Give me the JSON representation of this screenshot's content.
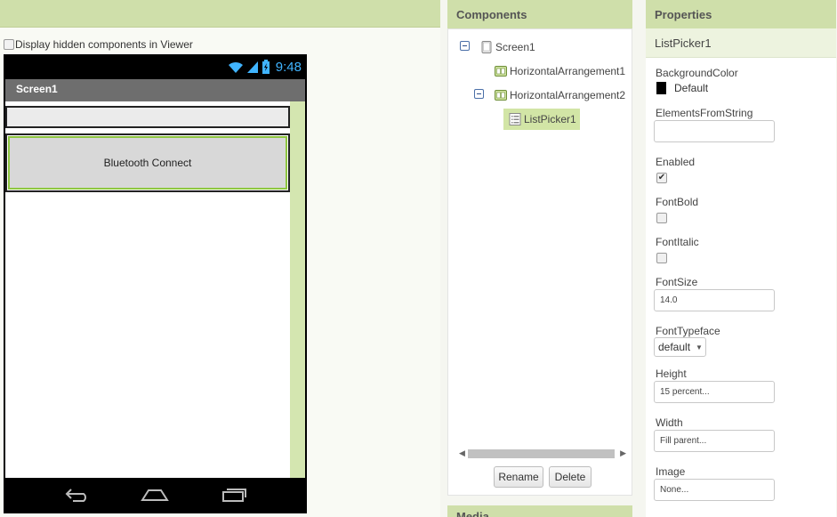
{
  "viewer": {
    "hidden_components_label": "Display hidden components in Viewer",
    "status_time": "9:48",
    "screen_title": "Screen1",
    "button_text": "Bluetooth Connect"
  },
  "components": {
    "header": "Components",
    "tree": [
      {
        "label": "Screen1",
        "icon": "screen-icon",
        "expanded": true
      },
      {
        "label": "HorizontalArrangement1",
        "icon": "horizontal-arrangement-icon"
      },
      {
        "label": "HorizontalArrangement2",
        "icon": "horizontal-arrangement-icon",
        "expanded": true
      },
      {
        "label": "ListPicker1",
        "icon": "list-picker-icon",
        "selected": true
      }
    ],
    "rename_label": "Rename",
    "delete_label": "Delete",
    "media_header": "Media"
  },
  "properties": {
    "header": "Properties",
    "selected_component": "ListPicker1",
    "background_color_label": "BackgroundColor",
    "background_color_value": "Default",
    "elements_from_string_label": "ElementsFromString",
    "elements_from_string_value": "",
    "enabled_label": "Enabled",
    "enabled_checked": true,
    "font_bold_label": "FontBold",
    "font_bold_checked": false,
    "font_italic_label": "FontItalic",
    "font_italic_checked": false,
    "font_size_label": "FontSize",
    "font_size_value": "14.0",
    "font_typeface_label": "FontTypeface",
    "font_typeface_value": "default",
    "height_label": "Height",
    "height_value": "15 percent...",
    "width_label": "Width",
    "width_value": "Fill parent...",
    "image_label": "Image",
    "image_value": "None..."
  },
  "colors": {
    "header_green": "#cfdfaa",
    "selected_green": "#d2e5a6",
    "button_border_green": "#8ec63f",
    "clock_blue": "#40b4ff"
  }
}
